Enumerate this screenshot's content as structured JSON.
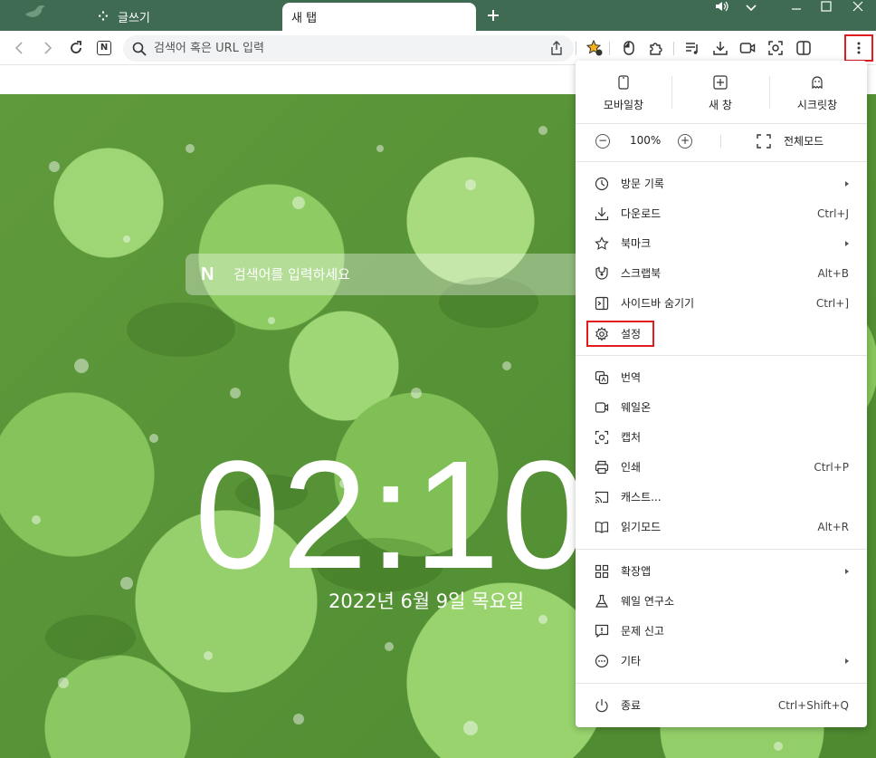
{
  "tabs": [
    {
      "label": "글쓰기",
      "active": false
    },
    {
      "label": "새 탭",
      "active": true
    }
  ],
  "toolbar": {
    "address_placeholder": "검색어 혹은 URL 입력"
  },
  "page": {
    "search_placeholder": "검색어를 입력하세요",
    "clock": "02:10",
    "date": "2022년 6월 9일 목요일"
  },
  "menu": {
    "top": [
      {
        "label": "모바일창",
        "icon": "mobile-window-icon"
      },
      {
        "label": "새 창",
        "icon": "new-window-icon"
      },
      {
        "label": "시크릿창",
        "icon": "secret-window-icon"
      }
    ],
    "zoom": {
      "minus": "−",
      "value": "100%",
      "plus": "+",
      "fullscreen_label": "전체모드"
    },
    "items": [
      {
        "label": "방문 기록",
        "shortcut": "",
        "submenu": true,
        "icon": "history-icon"
      },
      {
        "label": "다운로드",
        "shortcut": "Ctrl+J",
        "submenu": false,
        "icon": "download-icon"
      },
      {
        "label": "북마크",
        "shortcut": "",
        "submenu": true,
        "icon": "bookmark-star-icon"
      },
      {
        "label": "스크랩북",
        "shortcut": "Alt+B",
        "submenu": false,
        "icon": "scrapbook-icon"
      },
      {
        "label": "사이드바 숨기기",
        "shortcut": "Ctrl+]",
        "submenu": false,
        "icon": "sidebar-icon"
      },
      {
        "label": "설정",
        "shortcut": "",
        "submenu": false,
        "icon": "gear-icon"
      },
      {
        "label": "번역",
        "shortcut": "",
        "submenu": false,
        "icon": "translate-icon"
      },
      {
        "label": "웨일온",
        "shortcut": "",
        "submenu": false,
        "icon": "whale-on-icon"
      },
      {
        "label": "캡처",
        "shortcut": "",
        "submenu": false,
        "icon": "capture-icon"
      },
      {
        "label": "인쇄",
        "shortcut": "Ctrl+P",
        "submenu": false,
        "icon": "print-icon"
      },
      {
        "label": "캐스트...",
        "shortcut": "",
        "submenu": false,
        "icon": "cast-icon"
      },
      {
        "label": "읽기모드",
        "shortcut": "Alt+R",
        "submenu": false,
        "icon": "reading-mode-icon"
      },
      {
        "label": "확장앱",
        "shortcut": "",
        "submenu": true,
        "icon": "extensions-grid-icon"
      },
      {
        "label": "웨일 연구소",
        "shortcut": "",
        "submenu": false,
        "icon": "lab-flask-icon"
      },
      {
        "label": "문제 신고",
        "shortcut": "",
        "submenu": false,
        "icon": "report-icon"
      },
      {
        "label": "기타",
        "shortcut": "",
        "submenu": true,
        "icon": "more-dots-icon"
      },
      {
        "label": "종료",
        "shortcut": "Ctrl+Shift+Q",
        "submenu": false,
        "icon": "power-icon"
      }
    ]
  },
  "colors": {
    "tabstrip": "#3f6b52",
    "highlight": "#e01c1c"
  }
}
